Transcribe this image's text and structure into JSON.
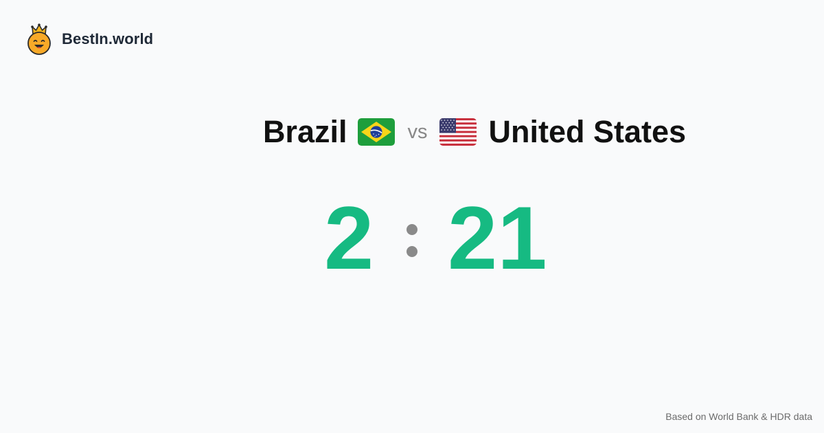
{
  "brand": {
    "name": "BestIn.world",
    "logo_icon": "crowned-smiley-icon"
  },
  "comparison": {
    "left_country": "Brazil",
    "left_flag_icon": "brazil-flag-icon",
    "vs_label": "vs",
    "right_country": "United States",
    "right_flag_icon": "us-flag-icon"
  },
  "score": {
    "left": "2",
    "right": "21",
    "color": "#16ba82",
    "separator_color": "#8a8a8a"
  },
  "footer": {
    "source_note": "Based on World Bank & HDR data"
  }
}
